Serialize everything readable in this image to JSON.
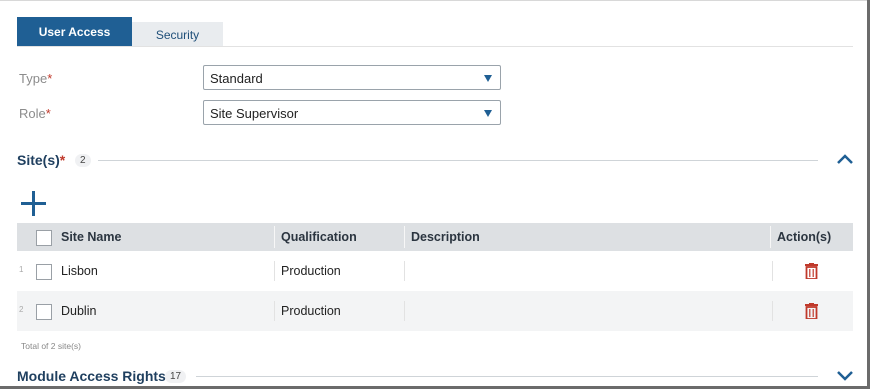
{
  "tabs": [
    {
      "label": "User Access",
      "active": true
    },
    {
      "label": "Security",
      "active": false
    }
  ],
  "form": {
    "type": {
      "label": "Type",
      "required_mark": "*",
      "value": "Standard"
    },
    "role": {
      "label": "Role",
      "required_mark": "*",
      "value": "Site Supervisor"
    }
  },
  "sites_section": {
    "title": "Site(s)",
    "required_mark": "*",
    "count": "2",
    "expanded": true,
    "columns": [
      "Site Name",
      "Qualification",
      "Description",
      "Action(s)"
    ],
    "rows": [
      {
        "num": "1",
        "site_name": "Lisbon",
        "qualification": "Production",
        "description": ""
      },
      {
        "num": "2",
        "site_name": "Dublin",
        "qualification": "Production",
        "description": ""
      }
    ],
    "total_text": "Total of 2 site(s)"
  },
  "module_section": {
    "title": "Module Access Rights",
    "count": "17",
    "expanded": false
  },
  "colors": {
    "accent": "#1f5f94",
    "required": "#c0392b",
    "delete": "#c0392b",
    "header_bg": "#dde0e3"
  }
}
